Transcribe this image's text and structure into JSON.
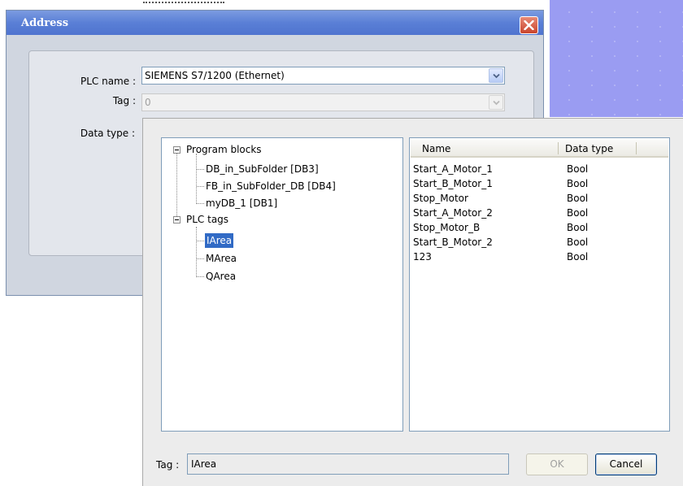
{
  "address_dialog": {
    "title": "Address",
    "plc_name_label": "PLC name :",
    "plc_name_value": "SIEMENS S7/1200 (Ethernet)",
    "tag_label": "Tag :",
    "tag_value": "0",
    "data_type_label": "Data type :"
  },
  "tag_browser": {
    "tree": {
      "groups": [
        {
          "label": "Program blocks",
          "children": [
            "DB_in_SubFolder [DB3]",
            "FB_in_SubFolder_DB [DB4]",
            "myDB_1 [DB1]"
          ]
        },
        {
          "label": "PLC tags",
          "children": [
            "IArea",
            "MArea",
            "QArea"
          ]
        }
      ],
      "selected": "IArea"
    },
    "list": {
      "columns": [
        "Name",
        "Data type"
      ],
      "rows": [
        {
          "name": "Start_A_Motor_1",
          "type": "Bool"
        },
        {
          "name": "Start_B_Motor_1",
          "type": "Bool"
        },
        {
          "name": "Stop_Motor",
          "type": "Bool"
        },
        {
          "name": "Start_A_Motor_2",
          "type": "Bool"
        },
        {
          "name": "Stop_Motor_B",
          "type": "Bool"
        },
        {
          "name": "Start_B_Motor_2",
          "type": "Bool"
        },
        {
          "name": "123",
          "type": "Bool"
        }
      ]
    },
    "footer": {
      "tag_label": "Tag :",
      "tag_value": "IArea",
      "ok_label": "OK",
      "cancel_label": "Cancel"
    }
  },
  "colors": {
    "titlebar": "#5a7fd6",
    "selection": "#316ac5",
    "background_grid": "#9a9cf2",
    "close_button": "#c9442c"
  },
  "icons": [
    "close-icon",
    "chevron-down-icon",
    "collapse-icon"
  ]
}
